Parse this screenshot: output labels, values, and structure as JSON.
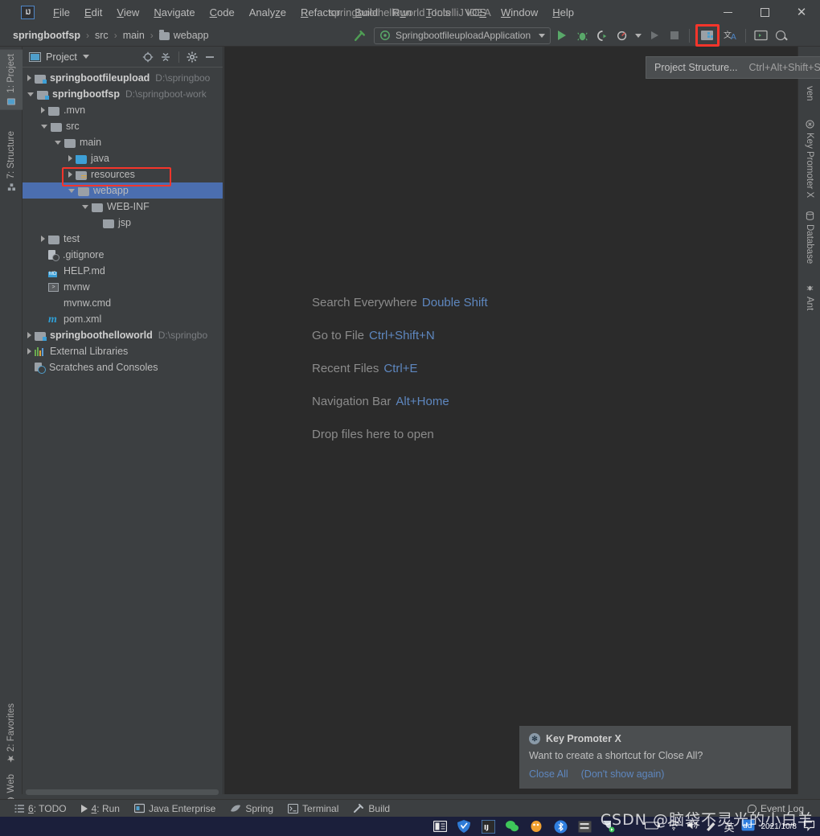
{
  "window": {
    "title": "springboothelloworld - IntelliJ IDEA",
    "logo": "intellij-idea-logo",
    "minimize": "–",
    "maximize": "□",
    "close": "✕"
  },
  "menu": [
    {
      "label": "File"
    },
    {
      "label": "Edit"
    },
    {
      "label": "View"
    },
    {
      "label": "Navigate"
    },
    {
      "label": "Code"
    },
    {
      "label": "Analyze"
    },
    {
      "label": "Refactor"
    },
    {
      "label": "Build"
    },
    {
      "label": "Run"
    },
    {
      "label": "Tools"
    },
    {
      "label": "VCS"
    },
    {
      "label": "Window"
    },
    {
      "label": "Help"
    }
  ],
  "navbar": {
    "crumbs": [
      "springbootfsp",
      "src",
      "main",
      "webapp"
    ],
    "separator": "›",
    "run_config": "SpringbootfileuploadApplication"
  },
  "tooltip": {
    "label": "Project Structure...",
    "shortcut": "Ctrl+Alt+Shift+S"
  },
  "project_panel": {
    "title": "Project",
    "tree": [
      {
        "indent": 0,
        "arrow": "right",
        "icon": "module-folder-icon",
        "label": "springbootfileupload",
        "bold": true,
        "path": "D:\\springboo"
      },
      {
        "indent": 0,
        "arrow": "down",
        "icon": "module-folder-icon",
        "label": "springbootfsp",
        "bold": true,
        "path": "D:\\springboot-work"
      },
      {
        "indent": 1,
        "arrow": "right",
        "icon": "folder-icon",
        "label": ".mvn",
        "bold": false,
        "path": ""
      },
      {
        "indent": 1,
        "arrow": "down",
        "icon": "folder-icon",
        "label": "src",
        "bold": false,
        "path": ""
      },
      {
        "indent": 2,
        "arrow": "down",
        "icon": "folder-icon",
        "label": "main",
        "bold": false,
        "path": ""
      },
      {
        "indent": 3,
        "arrow": "right",
        "icon": "source-folder-icon",
        "label": "java",
        "bold": false,
        "path": ""
      },
      {
        "indent": 3,
        "arrow": "right",
        "icon": "resources-folder-icon",
        "label": "resources",
        "bold": false,
        "path": ""
      },
      {
        "indent": 3,
        "arrow": "down",
        "icon": "folder-icon",
        "label": "webapp",
        "bold": false,
        "path": "",
        "selected": true,
        "highlighted": true
      },
      {
        "indent": 4,
        "arrow": "down",
        "icon": "folder-icon",
        "label": "WEB-INF",
        "bold": false,
        "path": ""
      },
      {
        "indent": 5,
        "arrow": "none",
        "icon": "folder-icon",
        "label": "jsp",
        "bold": false,
        "path": ""
      },
      {
        "indent": 1,
        "arrow": "right",
        "icon": "folder-icon",
        "label": "test",
        "bold": false,
        "path": ""
      },
      {
        "indent": 1,
        "arrow": "none",
        "icon": "gitignore-icon",
        "label": ".gitignore",
        "bold": false,
        "path": ""
      },
      {
        "indent": 1,
        "arrow": "none",
        "icon": "markdown-file-icon",
        "label": "HELP.md",
        "bold": false,
        "path": ""
      },
      {
        "indent": 1,
        "arrow": "none",
        "icon": "shell-script-icon",
        "label": "mvnw",
        "bold": false,
        "path": ""
      },
      {
        "indent": 1,
        "arrow": "none",
        "icon": "cmd-file-icon",
        "label": "mvnw.cmd",
        "bold": false,
        "path": ""
      },
      {
        "indent": 1,
        "arrow": "none",
        "icon": "maven-pom-icon",
        "label": "pom.xml",
        "bold": false,
        "path": ""
      },
      {
        "indent": 0,
        "arrow": "right",
        "icon": "module-folder-icon",
        "label": "springboothelloworld",
        "bold": true,
        "path": "D:\\springbo"
      },
      {
        "indent": 0,
        "arrow": "right",
        "icon": "libraries-icon",
        "label": "External Libraries",
        "bold": false,
        "path": ""
      },
      {
        "indent": 0,
        "arrow": "none",
        "icon": "scratches-icon",
        "label": "Scratches and Consoles",
        "bold": false,
        "path": ""
      }
    ]
  },
  "left_stripe": [
    {
      "label": "1: Project",
      "icon": "project-icon",
      "active": true
    },
    {
      "label": "7: Structure",
      "icon": "structure-icon",
      "active": false
    },
    {
      "label": "2: Favorites",
      "icon": "star-icon",
      "active": false
    },
    {
      "label": "Web",
      "icon": "web-icon",
      "active": false
    }
  ],
  "right_stripe": [
    {
      "label": "ven",
      "icon": "maven-icon"
    },
    {
      "label": "Key Promoter X",
      "icon": "key-promoter-icon"
    },
    {
      "label": "Database",
      "icon": "database-icon"
    },
    {
      "label": "Ant",
      "icon": "ant-icon"
    }
  ],
  "editor_hints": [
    {
      "label": "Search Everywhere",
      "key": "Double Shift"
    },
    {
      "label": "Go to File",
      "key": "Ctrl+Shift+N"
    },
    {
      "label": "Recent Files",
      "key": "Ctrl+E"
    },
    {
      "label": "Navigation Bar",
      "key": "Alt+Home"
    },
    {
      "label": "Drop files here to open",
      "key": ""
    }
  ],
  "notification": {
    "title": "Key Promoter X",
    "message": "Want to create a shortcut for Close All?",
    "primary_action": "Close All",
    "secondary_action": "(Don't show again)"
  },
  "statusbar": {
    "items": [
      {
        "label": "6: TODO",
        "icon": "todo-icon"
      },
      {
        "label": "4: Run",
        "icon": "run-icon"
      },
      {
        "label": "Java Enterprise",
        "icon": "java-enterprise-icon"
      },
      {
        "label": "Spring",
        "icon": "spring-leaf-icon"
      },
      {
        "label": "Terminal",
        "icon": "terminal-icon"
      },
      {
        "label": "Build",
        "icon": "build-hammer-icon"
      }
    ],
    "event_log": "Event Log"
  },
  "taskbar": {
    "clock_date": "2021/10/8",
    "watermark": "CSDN @脑袋不灵光的小白羊"
  },
  "colors": {
    "panel_bg": "#3c3f41",
    "editor_bg": "#2b2b2b",
    "selection_blue": "#4b6eaf",
    "annotation_red": "#f5352b",
    "link_blue": "#5e87bf",
    "accent_green": "#59a869"
  }
}
